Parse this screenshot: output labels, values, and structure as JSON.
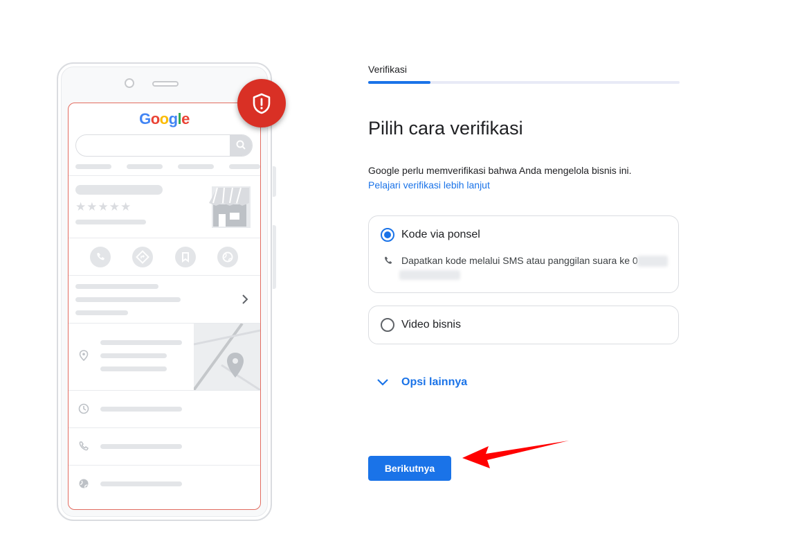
{
  "illustration": {
    "logo_letters": [
      {
        "char": "G",
        "color": "#4285F4"
      },
      {
        "char": "o",
        "color": "#EA4335"
      },
      {
        "char": "o",
        "color": "#FBBC05"
      },
      {
        "char": "g",
        "color": "#4285F4"
      },
      {
        "char": "l",
        "color": "#34A853"
      },
      {
        "char": "e",
        "color": "#EA4335"
      }
    ],
    "rating_stars": "★★★★★",
    "badge_icon": "shield-alert-icon",
    "badge_color": "#D93025"
  },
  "verification": {
    "step_label": "Verifikasi",
    "progress": 0.2,
    "heading": "Pilih cara verifikasi",
    "description": "Google perlu memverifikasi bahwa Anda mengelola bisnis ini.",
    "learn_more": "Pelajari verifikasi lebih lanjut",
    "options": [
      {
        "label": "Kode via ponsel",
        "selected": true,
        "detail_icon": "phone-icon",
        "detail": "Dapatkan kode melalui SMS atau panggilan suara ke 0"
      },
      {
        "label": "Video bisnis",
        "selected": false
      }
    ],
    "more_options": "Opsi lainnya",
    "next_button": "Berikutnya"
  },
  "colors": {
    "accent": "#1A73E8",
    "annotation_arrow": "#FF0000"
  }
}
